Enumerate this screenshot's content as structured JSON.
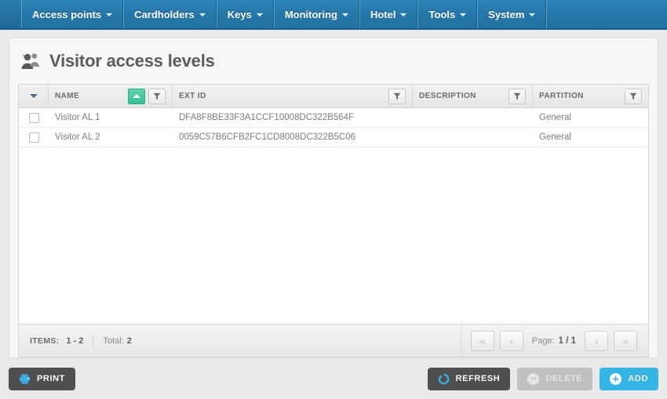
{
  "nav": {
    "items": [
      {
        "label": "Access points",
        "icon": "chevron-down-icon"
      },
      {
        "label": "Cardholders",
        "icon": "chevron-down-icon"
      },
      {
        "label": "Keys",
        "icon": "chevron-down-icon"
      },
      {
        "label": "Monitoring",
        "icon": "chevron-down-icon"
      },
      {
        "label": "Hotel",
        "icon": "chevron-down-icon"
      },
      {
        "label": "Tools",
        "icon": "chevron-down-icon"
      },
      {
        "label": "System",
        "icon": "chevron-down-icon"
      }
    ]
  },
  "page": {
    "title": "Visitor access levels",
    "title_icon": "visitors-group-icon"
  },
  "grid": {
    "select_all_icon": "chevron-down-icon",
    "columns": [
      {
        "key": "check",
        "label": "",
        "filter": false,
        "sort": null
      },
      {
        "key": "name",
        "label": "NAME",
        "filter": true,
        "sort": "asc",
        "sort_icon": "sort-ascending-icon",
        "filter_icon": "filter-funnel-icon"
      },
      {
        "key": "extid",
        "label": "EXT ID",
        "filter": true,
        "sort": null,
        "filter_icon": "filter-funnel-icon"
      },
      {
        "key": "description",
        "label": "DESCRIPTION",
        "filter": true,
        "sort": null,
        "filter_icon": "filter-funnel-icon"
      },
      {
        "key": "partition",
        "label": "PARTITION",
        "filter": true,
        "sort": null,
        "filter_icon": "filter-funnel-icon"
      }
    ],
    "rows": [
      {
        "selected": false,
        "name": "Visitor AL 1",
        "extid": "DFA8F8BE33F3A1CCF10008DC322B564F",
        "description": "",
        "partition": "General"
      },
      {
        "selected": false,
        "name": "Visitor AL 2",
        "extid": "0059C57B6CFB2FC1CD8008DC322B5C06",
        "description": "",
        "partition": "General"
      }
    ],
    "footer": {
      "items_label": "ITEMS:",
      "items_range": "1 - 2",
      "total_label": "Total:",
      "total_value": "2",
      "page_label": "Page:",
      "page_value": "1 / 1",
      "first_icon": "double-chevron-left-icon",
      "prev_icon": "chevron-left-icon",
      "next_icon": "chevron-right-icon",
      "last_icon": "double-chevron-right-icon"
    }
  },
  "actions": {
    "print": {
      "label": "PRINT",
      "icon": "printer-icon"
    },
    "refresh": {
      "label": "REFRESH",
      "icon": "refresh-icon"
    },
    "delete": {
      "label": "DELETE",
      "icon": "minus-circle-icon",
      "disabled": true
    },
    "add": {
      "label": "ADD",
      "icon": "plus-circle-icon"
    }
  },
  "colors": {
    "navbar": "#2577ab",
    "accent_blue": "#33b5e5",
    "sort_green": "#35bf94",
    "dark_button": "#4f4f4f",
    "disabled_gray": "#c0c0c0",
    "page_background": "#e9e9e9",
    "card_background": "#f7f7f7"
  }
}
